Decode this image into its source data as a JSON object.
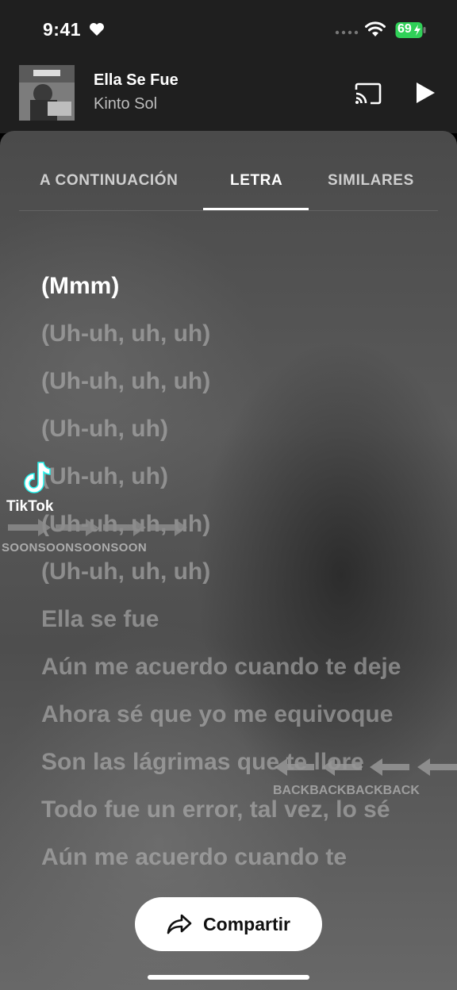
{
  "status_bar": {
    "time": "9:41",
    "battery": "69"
  },
  "now_playing": {
    "title": "Ella Se Fue",
    "artist": "Kinto Sol"
  },
  "tabs": [
    {
      "label": "A CONTINUACIÓN",
      "selected": false
    },
    {
      "label": "LETRA",
      "selected": true
    },
    {
      "label": "SIMILARES",
      "selected": false
    }
  ],
  "lyrics": [
    {
      "text": "(Mmm)",
      "active": true
    },
    {
      "text": "(Uh-uh, uh, uh)",
      "active": false
    },
    {
      "text": "(Uh-uh, uh, uh)",
      "active": false
    },
    {
      "text": "(Uh-uh, uh)",
      "active": false
    },
    {
      "text": "(Uh-uh, uh)",
      "active": false
    },
    {
      "text": "(Uh-uh, uh, uh)",
      "active": false
    },
    {
      "text": "(Uh-uh, uh, uh)",
      "active": false
    },
    {
      "text": "Ella se fue",
      "active": false
    },
    {
      "text": "Aún me acuerdo cuando te deje",
      "active": false
    },
    {
      "text": "Ahora sé que yo me equivoque",
      "active": false
    },
    {
      "text": "Son las lágrimas que te llore",
      "active": false
    },
    {
      "text": "Todo fue un error, tal vez, lo sé",
      "active": false
    },
    {
      "text": "Aún me acuerdo cuando te",
      "active": false
    }
  ],
  "share_button": {
    "label": "Compartir"
  },
  "overlays": {
    "tiktok_label": "TikTok",
    "soon_text": "SOONSOONSOONSOON",
    "back_text": "BACKBACKBACKBACK"
  },
  "colors": {
    "background": "#1f1f1f",
    "battery_green": "#30d158",
    "share_bg": "#ffffff"
  }
}
